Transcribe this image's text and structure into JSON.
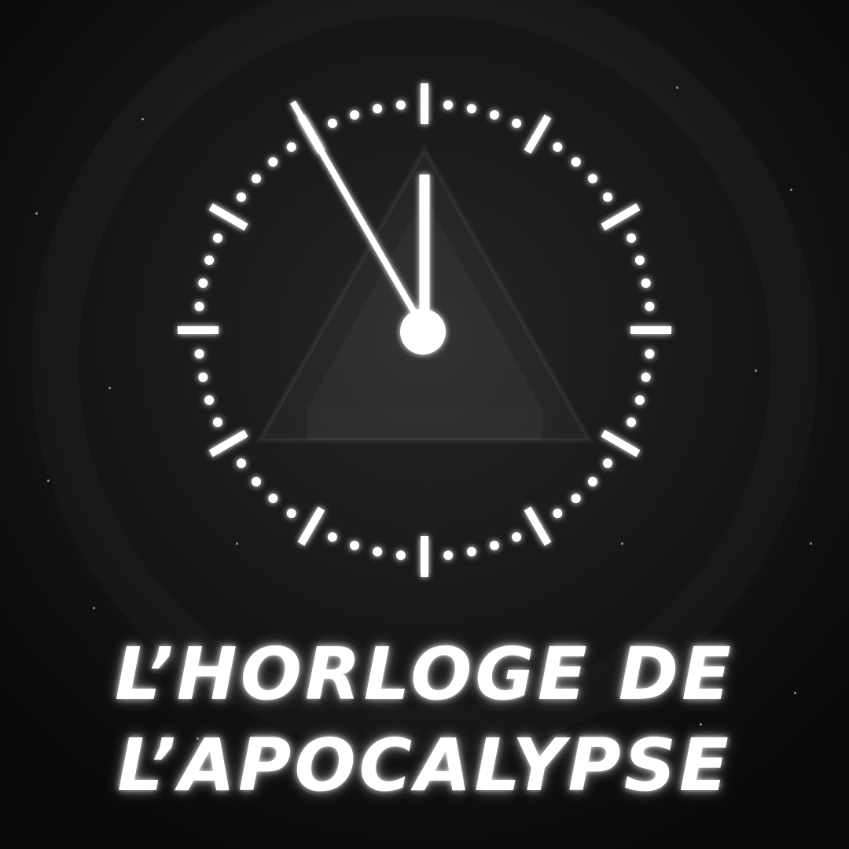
{
  "title": {
    "line1": "l’horloge de",
    "line2": "L’apocalypse"
  },
  "clock": {
    "color": "#ffffff",
    "hour_hand_points_to": 12,
    "minute_hand_points_to_minutes": 55
  },
  "icons": {
    "clock": "clock-icon",
    "pyramid": "pyramid-icon"
  },
  "colors": {
    "background": "#0b0b0b",
    "accent": "#ffffff"
  }
}
